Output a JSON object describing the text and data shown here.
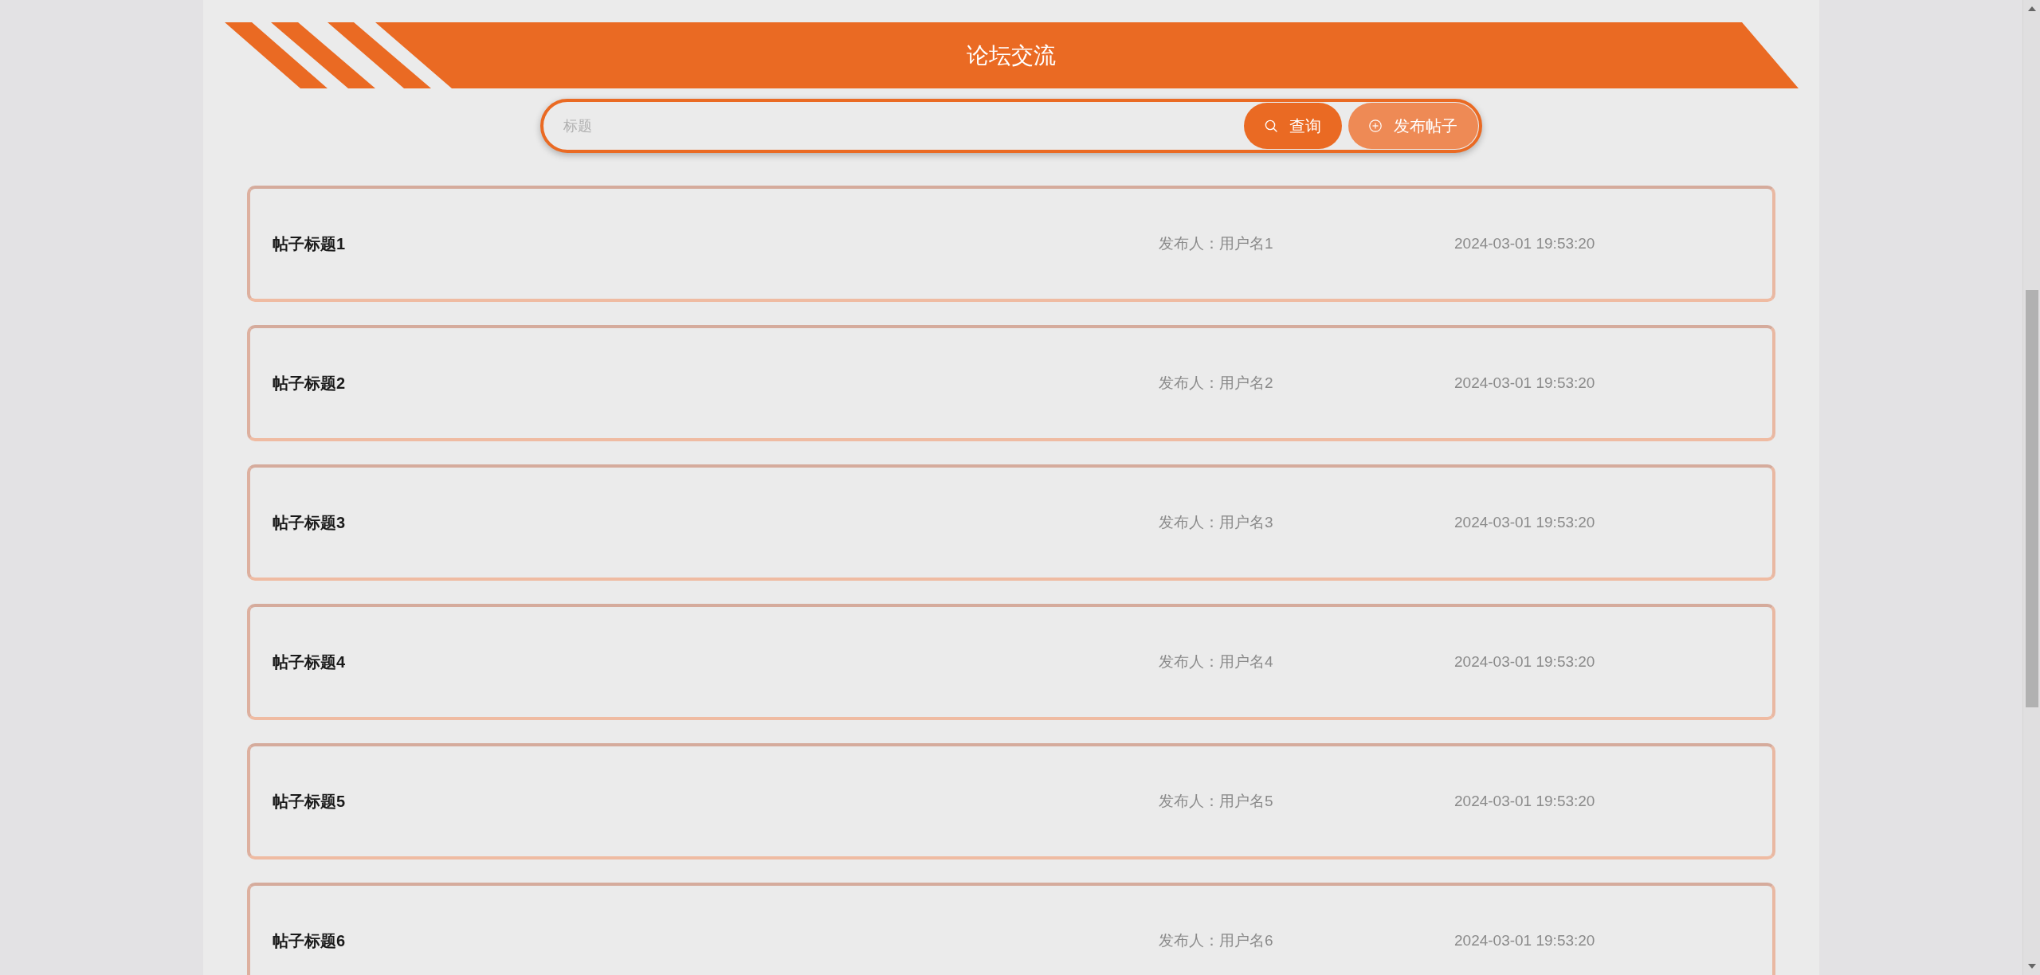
{
  "header": {
    "title": "论坛交流"
  },
  "search": {
    "placeholder": "标题",
    "buttons": [
      {
        "label": "查询",
        "kind": "search",
        "hovered": false
      },
      {
        "label": "发布帖子",
        "kind": "add",
        "hovered": true
      }
    ]
  },
  "posts": [
    {
      "title": "帖子标题1",
      "author": "发布人：用户名1",
      "time": "2024-03-01 19:53:20"
    },
    {
      "title": "帖子标题2",
      "author": "发布人：用户名2",
      "time": "2024-03-01 19:53:20"
    },
    {
      "title": "帖子标题3",
      "author": "发布人：用户名3",
      "time": "2024-03-01 19:53:20"
    },
    {
      "title": "帖子标题4",
      "author": "发布人：用户名4",
      "time": "2024-03-01 19:53:20"
    },
    {
      "title": "帖子标题5",
      "author": "发布人：用户名5",
      "time": "2024-03-01 19:53:20"
    },
    {
      "title": "帖子标题6",
      "author": "发布人：用户名6",
      "time": "2024-03-01 19:53:20"
    }
  ]
}
